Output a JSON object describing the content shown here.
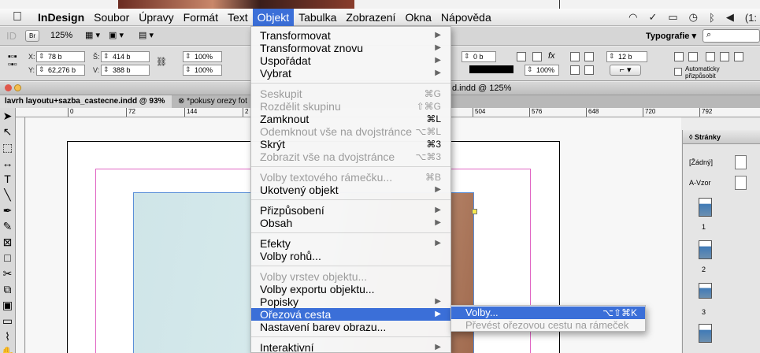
{
  "menubar": {
    "app": "InDesign",
    "items": [
      "Soubor",
      "Úpravy",
      "Formát",
      "Text",
      "Objekt",
      "Tabulka",
      "Zobrazení",
      "Okna",
      "Nápověda"
    ],
    "active": "Objekt",
    "clock": "(1:"
  },
  "appbar": {
    "zoom": "125%",
    "workspace": "Typografie ▾"
  },
  "control": {
    "x": "78 b",
    "y": "62,276 b",
    "w": "414 b",
    "h": "388 b",
    "scale1": "100%",
    "scale2": "100%",
    "stroke": "0 b",
    "opacity": "100%",
    "size2": "12 b",
    "autofit": "Automaticky přizpůsobit"
  },
  "document": {
    "window_title": "d.indd @ 125%",
    "tabs": [
      "lavrh layoutu+sazba_castecne.indd @ 93%",
      "*pokusy orezy fot"
    ]
  },
  "ruler": [
    "0",
    "72",
    "144",
    "2",
    "504",
    "576",
    "648",
    "720",
    "792"
  ],
  "pages_panel": {
    "title": "◊ Stránky",
    "masters": [
      "[Žádný]",
      "A-Vzor"
    ],
    "pages": [
      "1",
      "2",
      "3"
    ]
  },
  "menu": [
    {
      "label": "Transformovat",
      "arrow": true
    },
    {
      "label": "Transformovat znovu",
      "arrow": true
    },
    {
      "label": "Uspořádat",
      "arrow": true
    },
    {
      "label": "Vybrat",
      "arrow": true
    },
    {
      "label": "Seskupit",
      "shortcut": "⌘G",
      "disabled": true
    },
    {
      "label": "Rozdělit skupinu",
      "shortcut": "⇧⌘G",
      "disabled": true
    },
    {
      "label": "Zamknout",
      "shortcut": "⌘L"
    },
    {
      "label": "Odemknout vše na dvojstránce",
      "shortcut": "⌥⌘L",
      "disabled": true
    },
    {
      "label": "Skrýt",
      "shortcut": "⌘3"
    },
    {
      "label": "Zobrazit vše na dvojstránce",
      "shortcut": "⌥⌘3",
      "disabled": true
    },
    {
      "label": "Volby textového rámečku...",
      "shortcut": "⌘B",
      "disabled": true
    },
    {
      "label": "Ukotvený objekt",
      "arrow": true
    },
    {
      "label": "Přizpůsobení",
      "arrow": true
    },
    {
      "label": "Obsah",
      "arrow": true
    },
    {
      "label": "Efekty",
      "arrow": true
    },
    {
      "label": "Volby rohů..."
    },
    {
      "label": "Volby vrstev objektu...",
      "disabled": true
    },
    {
      "label": "Volby exportu objektu..."
    },
    {
      "label": "Popisky",
      "arrow": true
    },
    {
      "label": "Ořezová cesta",
      "arrow": true,
      "highlighted": true
    },
    {
      "label": "Nastavení barev obrazu..."
    },
    {
      "label": "Interaktivní",
      "arrow": true
    }
  ],
  "submenu": [
    {
      "label": "Volby...",
      "shortcut": "⌥⇧⌘K",
      "highlighted": true
    },
    {
      "label": "Převést ořezovou cestu na rámeček",
      "disabled": true
    }
  ],
  "colors": {
    "highlight": "#3b6fd8",
    "margin": "#e066c4",
    "frame": "#5a8fd8"
  }
}
